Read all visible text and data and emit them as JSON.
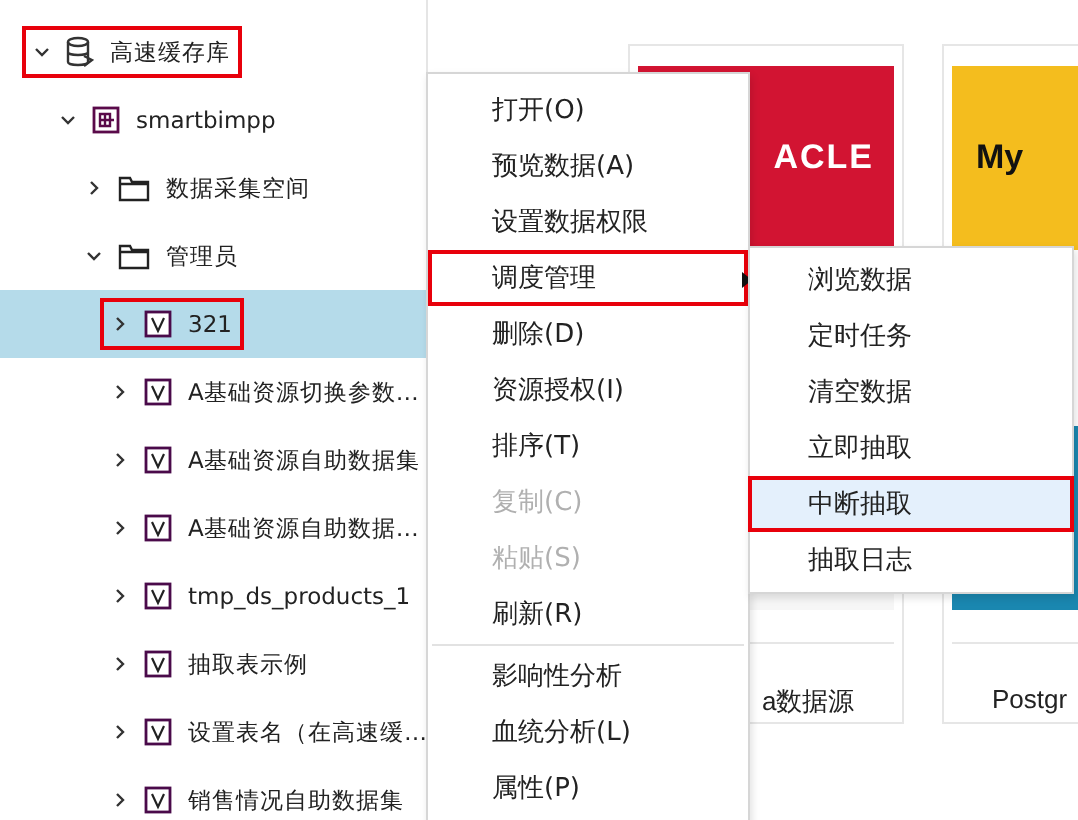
{
  "tree": [
    {
      "label": "高速缓存库",
      "kind": "database",
      "expanded": true,
      "selected": false,
      "marked": true,
      "children": [
        {
          "label": "smartbimpp",
          "kind": "schema",
          "expanded": true,
          "selected": false,
          "marked": false,
          "children": [
            {
              "label": "数据采集空间",
              "kind": "folder",
              "expanded": false,
              "selected": false,
              "marked": false
            },
            {
              "label": "管理员",
              "kind": "folder",
              "expanded": true,
              "selected": false,
              "marked": false,
              "children": [
                {
                  "label": "321",
                  "kind": "view",
                  "expanded": false,
                  "selected": true,
                  "marked": true
                },
                {
                  "label": "A基础资源切换参数…",
                  "kind": "view",
                  "expanded": false,
                  "selected": false,
                  "marked": false
                },
                {
                  "label": "A基础资源自助数据集",
                  "kind": "view",
                  "expanded": false,
                  "selected": false,
                  "marked": false
                },
                {
                  "label": "A基础资源自助数据…",
                  "kind": "view",
                  "expanded": false,
                  "selected": false,
                  "marked": false
                },
                {
                  "label": "tmp_ds_products_1",
                  "kind": "view",
                  "expanded": false,
                  "selected": false,
                  "marked": false
                },
                {
                  "label": "抽取表示例",
                  "kind": "view",
                  "expanded": false,
                  "selected": false,
                  "marked": false
                },
                {
                  "label": "设置表名（在高速缓…",
                  "kind": "view",
                  "expanded": false,
                  "selected": false,
                  "marked": false
                },
                {
                  "label": "销售情况自助数据集",
                  "kind": "view",
                  "expanded": false,
                  "selected": false,
                  "marked": false
                }
              ]
            }
          ]
        }
      ]
    }
  ],
  "cards": [
    {
      "logo_text": "ACLE",
      "color": "#d21432",
      "caption": "a数据源"
    },
    {
      "logo_text": "My",
      "color": "#f4bd1e",
      "caption": "Postgr"
    }
  ],
  "context_menu": {
    "items": [
      {
        "kind": "item",
        "label": "打开(O)",
        "disabled": false,
        "marked": false
      },
      {
        "kind": "item",
        "label": "预览数据(A)",
        "disabled": false,
        "marked": false
      },
      {
        "kind": "item",
        "label": "设置数据权限",
        "disabled": false,
        "marked": false
      },
      {
        "kind": "submenu",
        "label": "调度管理",
        "disabled": false,
        "marked": true
      },
      {
        "kind": "item",
        "label": "删除(D)",
        "disabled": false,
        "marked": false
      },
      {
        "kind": "item",
        "label": "资源授权(I)",
        "disabled": false,
        "marked": false
      },
      {
        "kind": "item",
        "label": "排序(T)",
        "disabled": false,
        "marked": false
      },
      {
        "kind": "item",
        "label": "复制(C)",
        "disabled": true,
        "marked": false
      },
      {
        "kind": "item",
        "label": "粘贴(S)",
        "disabled": true,
        "marked": false
      },
      {
        "kind": "item",
        "label": "刷新(R)",
        "disabled": false,
        "marked": false
      },
      {
        "kind": "separator"
      },
      {
        "kind": "item",
        "label": "影响性分析",
        "disabled": false,
        "marked": false
      },
      {
        "kind": "item",
        "label": "血统分析(L)",
        "disabled": false,
        "marked": false
      },
      {
        "kind": "item",
        "label": "属性(P)",
        "disabled": false,
        "marked": false
      }
    ]
  },
  "submenu": {
    "items": [
      {
        "label": "浏览数据",
        "selected": false,
        "marked": false
      },
      {
        "label": "定时任务",
        "selected": false,
        "marked": false
      },
      {
        "label": "清空数据",
        "selected": false,
        "marked": false
      },
      {
        "label": "立即抽取",
        "selected": false,
        "marked": false
      },
      {
        "label": "中断抽取",
        "selected": true,
        "marked": true
      },
      {
        "label": "抽取日志",
        "selected": false,
        "marked": false
      }
    ]
  }
}
